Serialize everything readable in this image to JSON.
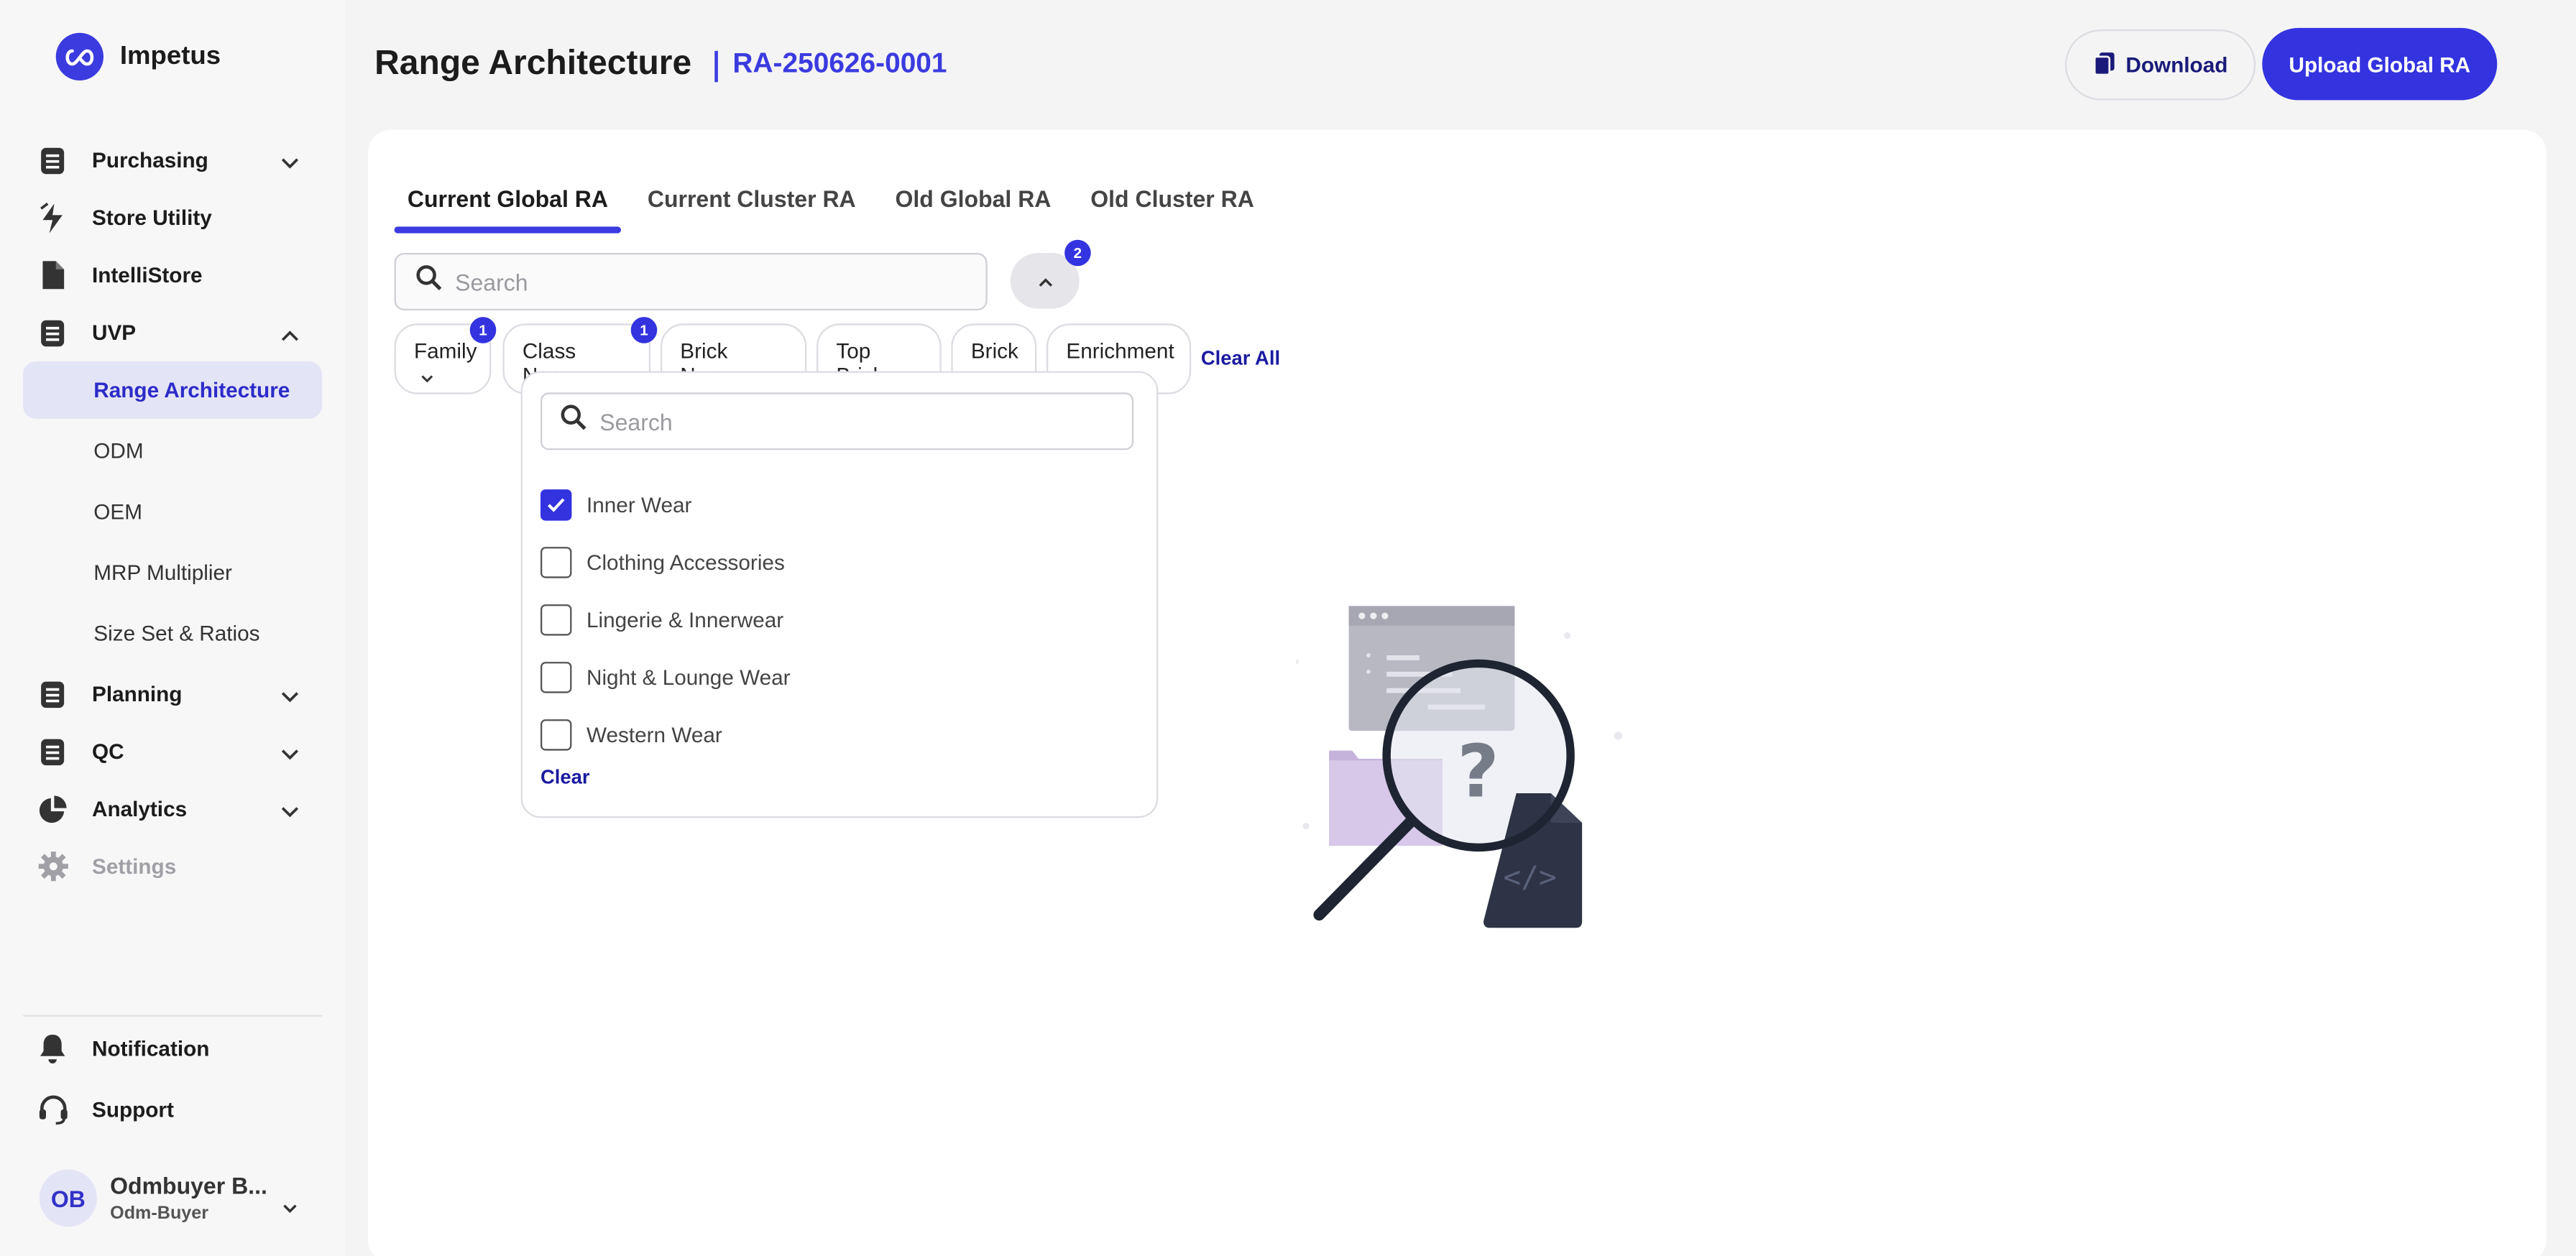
{
  "brand": {
    "name": "Impetus"
  },
  "sidebar": {
    "items": [
      {
        "label": "Purchasing",
        "icon": "document-icon",
        "expandable": true,
        "expanded": false
      },
      {
        "label": "Store Utility",
        "icon": "bolt-icon",
        "expandable": false
      },
      {
        "label": "IntelliStore",
        "icon": "file-icon",
        "expandable": false
      },
      {
        "label": "UVP",
        "icon": "document-icon",
        "expandable": true,
        "expanded": true
      }
    ],
    "uvp_sub": [
      {
        "label": "Range Architecture",
        "active": true
      },
      {
        "label": "ODM",
        "active": false
      },
      {
        "label": "OEM",
        "active": false
      },
      {
        "label": "MRP Multiplier",
        "active": false
      },
      {
        "label": "Size Set & Ratios",
        "active": false
      }
    ],
    "items_after": [
      {
        "label": "Planning",
        "icon": "document-icon"
      },
      {
        "label": "QC",
        "icon": "document-icon"
      },
      {
        "label": "Analytics",
        "icon": "pie-chart-icon"
      }
    ],
    "settings_label": "Settings",
    "bottom": [
      {
        "label": "Notification",
        "icon": "bell-icon"
      },
      {
        "label": "Support",
        "icon": "headset-icon"
      }
    ],
    "user": {
      "initials": "OB",
      "name": "Odmbuyer B...",
      "role": "Odm-Buyer"
    }
  },
  "header": {
    "title": "Range Architecture",
    "ra_id": "RA-250626-0001",
    "download_label": "Download",
    "upload_label": "Upload Global RA"
  },
  "tabs": [
    {
      "label": "Current Global RA",
      "active": true
    },
    {
      "label": "Current Cluster RA",
      "active": false
    },
    {
      "label": "Old Global RA",
      "active": false
    },
    {
      "label": "Old Cluster RA",
      "active": false
    }
  ],
  "search": {
    "placeholder": "Search"
  },
  "filter_toggle_badge": "2",
  "chips": [
    {
      "label": "Family",
      "badge": "1"
    },
    {
      "label": "Class Name",
      "badge": "1"
    },
    {
      "label": "Brick Name"
    },
    {
      "label": "Top Brick"
    },
    {
      "label": "Brick"
    },
    {
      "label": "Enrichment"
    }
  ],
  "clear_all_label": "Clear All",
  "dropdown": {
    "search_placeholder": "Search",
    "options": [
      {
        "label": "Inner Wear",
        "checked": true
      },
      {
        "label": "Clothing Accessories",
        "checked": false
      },
      {
        "label": "Lingerie & Innerwear",
        "checked": false
      },
      {
        "label": "Night & Lounge Wear",
        "checked": false
      },
      {
        "label": "Western Wear",
        "checked": false
      }
    ],
    "clear_label": "Clear"
  },
  "colors": {
    "accent": "#3333e0",
    "active_bg": "#e4e4f7",
    "link": "#1a1aa0"
  }
}
